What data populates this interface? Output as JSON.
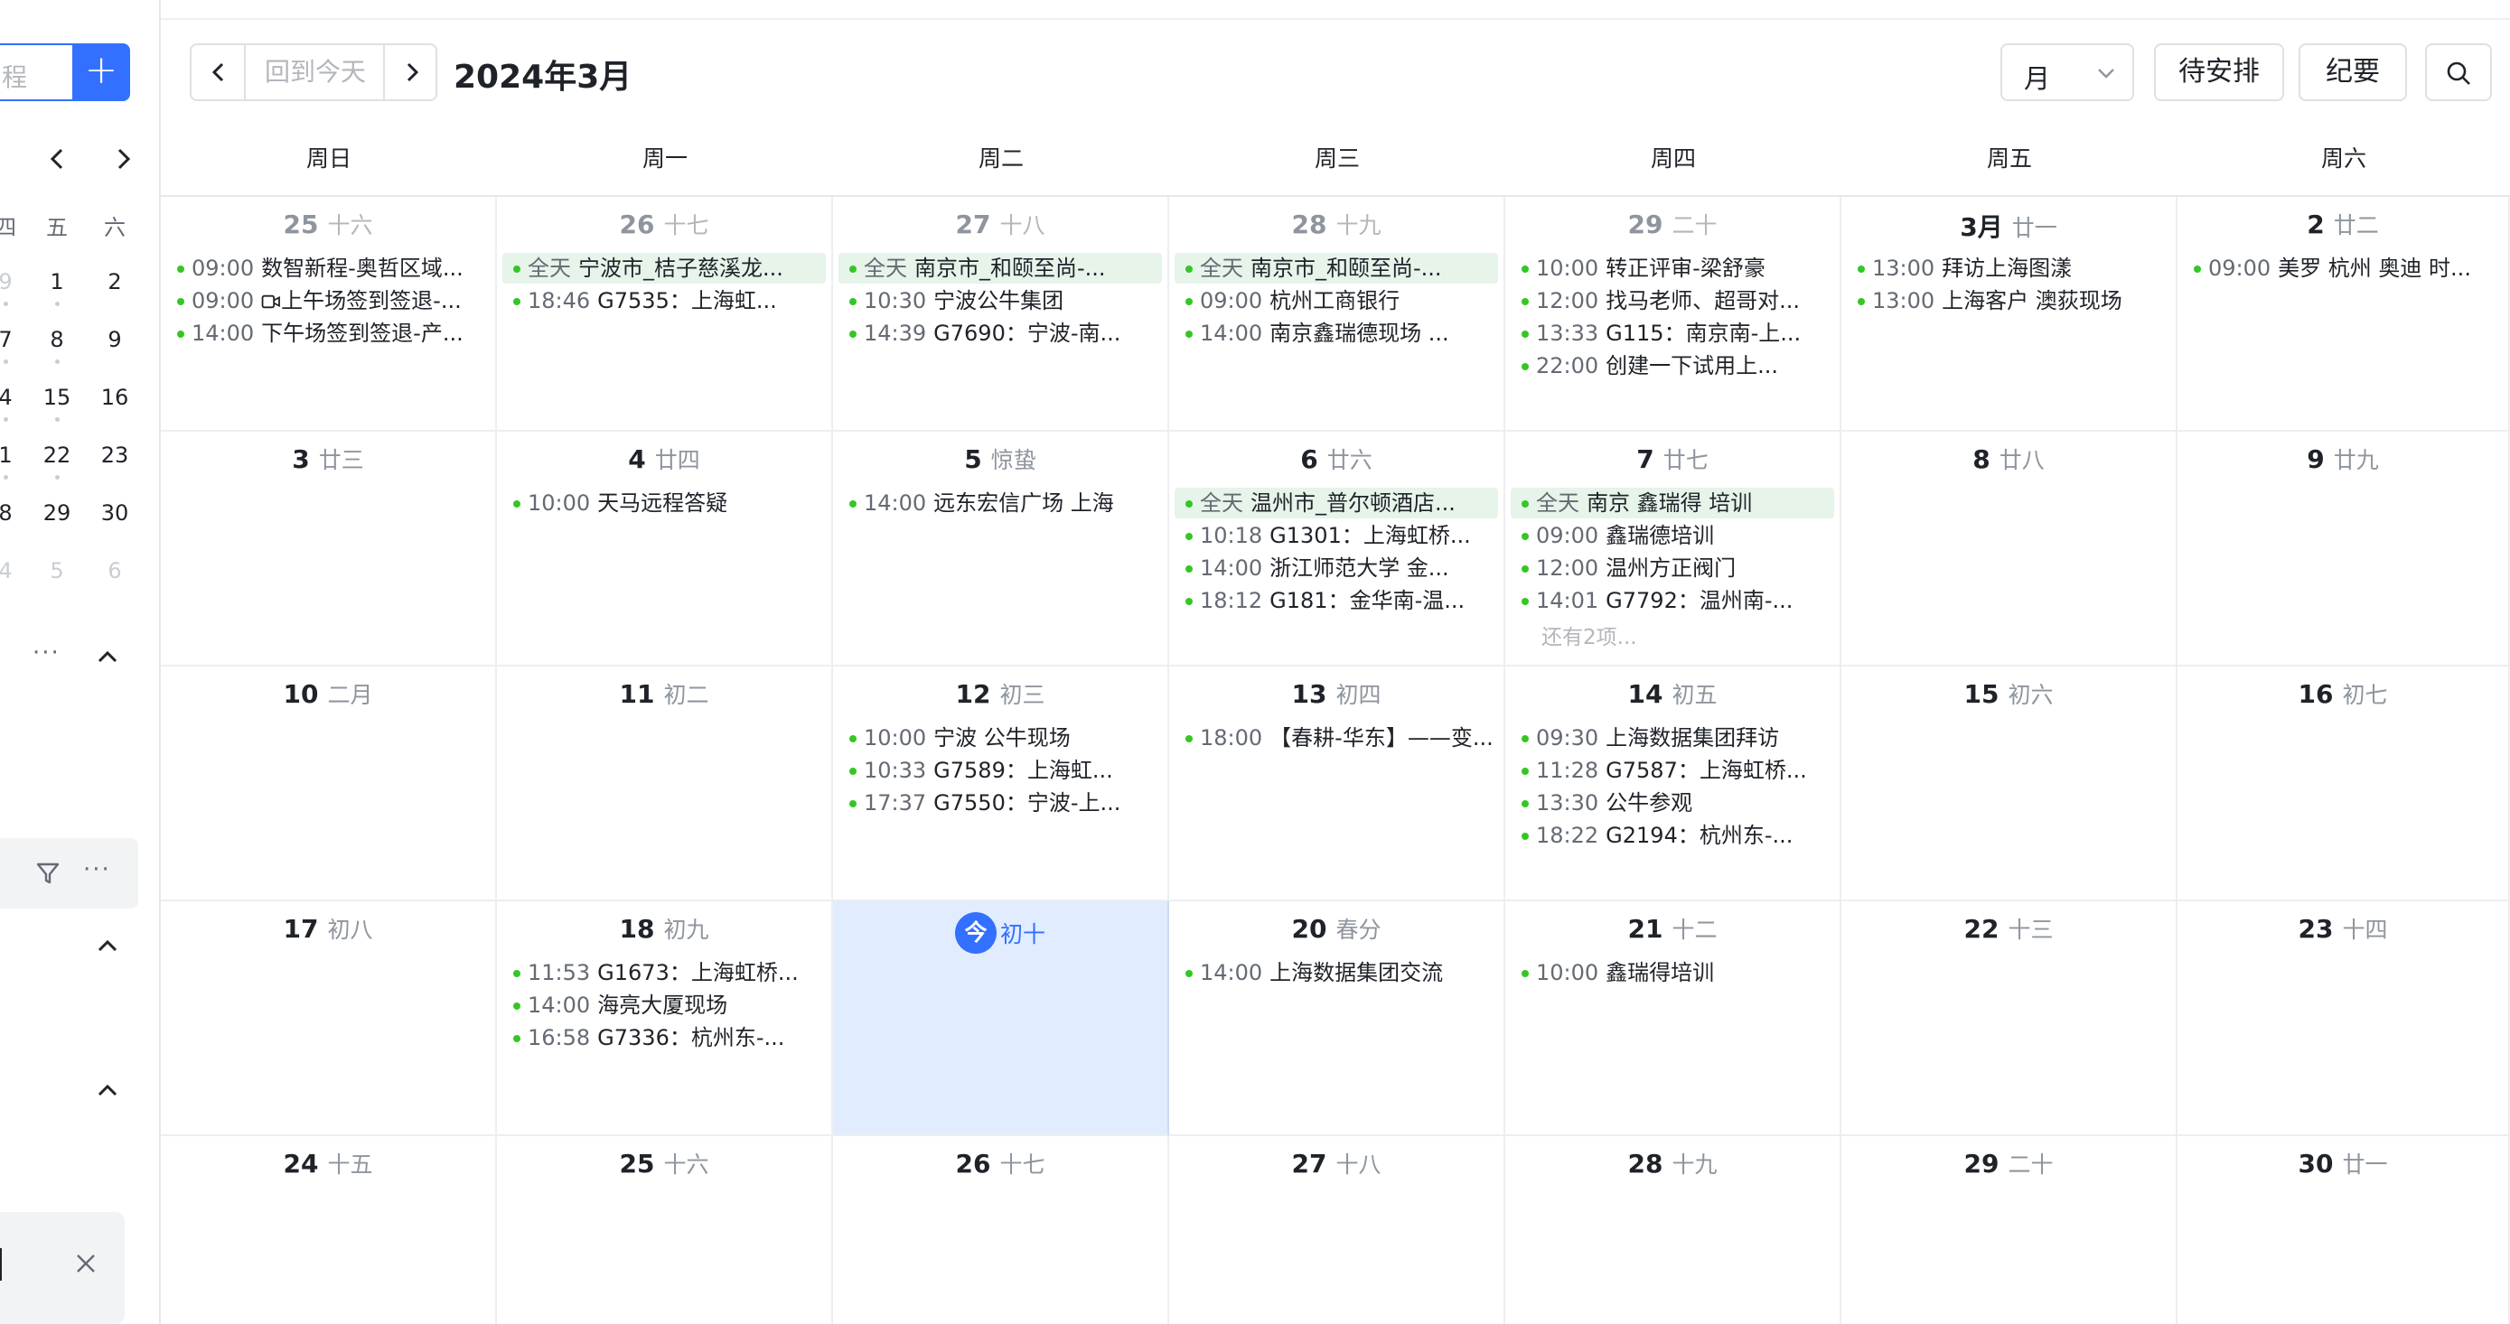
{
  "toolbar": {
    "search_partial": "程",
    "add": "+",
    "today": "回到今天",
    "title": "2024年3月",
    "view": "月",
    "pending": "待安排",
    "minutes": "纪要"
  },
  "mini_calendar": {
    "weekday_heads": [
      "四",
      "五",
      "六"
    ],
    "rows": [
      [
        "9",
        "1",
        "2"
      ],
      [
        "7",
        "8",
        "9"
      ],
      [
        "4",
        "15",
        "16"
      ],
      [
        "1",
        "22",
        "23"
      ],
      [
        "8",
        "29",
        "30"
      ],
      [
        "4",
        "5",
        "6"
      ]
    ]
  },
  "weekdays": [
    "周日",
    "周一",
    "周二",
    "周三",
    "周四",
    "周五",
    "周六"
  ],
  "today_badge": "今",
  "weeks": [
    [
      {
        "num": "25",
        "lunar": "十六",
        "other": true,
        "events": [
          {
            "time": "09:00",
            "title": "数智新程-奥哲区域..."
          },
          {
            "time": "09:00",
            "title": "上午场签到签退-...",
            "icon": "video"
          },
          {
            "time": "14:00",
            "title": "下午场签到签退-产..."
          }
        ]
      },
      {
        "num": "26",
        "lunar": "十七",
        "other": true,
        "events": [
          {
            "time": "全天",
            "title": "宁波市_桔子慈溪龙...",
            "allday": true
          },
          {
            "time": "18:46",
            "title": "G7535：上海虹..."
          }
        ]
      },
      {
        "num": "27",
        "lunar": "十八",
        "other": true,
        "events": [
          {
            "time": "全天",
            "title": "南京市_和颐至尚-...",
            "allday": true
          },
          {
            "time": "10:30",
            "title": "宁波公牛集团"
          },
          {
            "time": "14:39",
            "title": "G7690：宁波-南..."
          }
        ]
      },
      {
        "num": "28",
        "lunar": "十九",
        "other": true,
        "events": [
          {
            "time": "全天",
            "title": "南京市_和颐至尚-...",
            "allday": true
          },
          {
            "time": "09:00",
            "title": "杭州工商银行"
          },
          {
            "time": "14:00",
            "title": "南京鑫瑞德现场 ..."
          }
        ]
      },
      {
        "num": "29",
        "lunar": "二十",
        "other": true,
        "events": [
          {
            "time": "10:00",
            "title": "转正评审-梁舒豪"
          },
          {
            "time": "12:00",
            "title": "找马老师、超哥对..."
          },
          {
            "time": "13:33",
            "title": "G115：南京南-上..."
          },
          {
            "time": "22:00",
            "title": "创建一下试用上..."
          }
        ]
      },
      {
        "num": "3月",
        "lunar": "廿一",
        "events": [
          {
            "time": "13:00",
            "title": "拜访上海图漾"
          },
          {
            "time": "13:00",
            "title": "上海客户 澳荻现场"
          }
        ]
      },
      {
        "num": "2",
        "lunar": "廿二",
        "events": [
          {
            "time": "09:00",
            "title": "美罗 杭州 奥迪 时..."
          }
        ]
      }
    ],
    [
      {
        "num": "3",
        "lunar": "廿三",
        "events": []
      },
      {
        "num": "4",
        "lunar": "廿四",
        "events": [
          {
            "time": "10:00",
            "title": "天马远程答疑"
          }
        ]
      },
      {
        "num": "5",
        "lunar": "惊蛰",
        "events": [
          {
            "time": "14:00",
            "title": "远东宏信广场 上海"
          }
        ]
      },
      {
        "num": "6",
        "lunar": "廿六",
        "events": [
          {
            "time": "全天",
            "title": "温州市_普尔顿酒店...",
            "allday": true
          },
          {
            "time": "10:18",
            "title": "G1301：上海虹桥..."
          },
          {
            "time": "14:00",
            "title": "浙江师范大学 金..."
          },
          {
            "time": "18:12",
            "title": "G181：金华南-温..."
          }
        ]
      },
      {
        "num": "7",
        "lunar": "廿七",
        "more": "还有2项...",
        "events": [
          {
            "time": "全天",
            "title": "南京 鑫瑞得 培训",
            "allday": true
          },
          {
            "time": "09:00",
            "title": "鑫瑞德培训"
          },
          {
            "time": "12:00",
            "title": "温州方正阀门"
          },
          {
            "time": "14:01",
            "title": "G7792：温州南-..."
          }
        ]
      },
      {
        "num": "8",
        "lunar": "廿八",
        "events": []
      },
      {
        "num": "9",
        "lunar": "廿九",
        "events": []
      }
    ],
    [
      {
        "num": "10",
        "lunar": "二月",
        "events": []
      },
      {
        "num": "11",
        "lunar": "初二",
        "events": []
      },
      {
        "num": "12",
        "lunar": "初三",
        "events": [
          {
            "time": "10:00",
            "title": "宁波 公牛现场"
          },
          {
            "time": "10:33",
            "title": "G7589：上海虹..."
          },
          {
            "time": "17:37",
            "title": "G7550：宁波-上..."
          }
        ]
      },
      {
        "num": "13",
        "lunar": "初四",
        "events": [
          {
            "time": "18:00",
            "title": "【春耕-华东】——变..."
          }
        ]
      },
      {
        "num": "14",
        "lunar": "初五",
        "events": [
          {
            "time": "09:30",
            "title": "上海数据集团拜访"
          },
          {
            "time": "11:28",
            "title": "G7587：上海虹桥..."
          },
          {
            "time": "13:30",
            "title": "公牛参观"
          },
          {
            "time": "18:22",
            "title": "G2194：杭州东-..."
          }
        ]
      },
      {
        "num": "15",
        "lunar": "初六",
        "events": []
      },
      {
        "num": "16",
        "lunar": "初七",
        "events": []
      }
    ],
    [
      {
        "num": "17",
        "lunar": "初八",
        "events": []
      },
      {
        "num": "18",
        "lunar": "初九",
        "events": [
          {
            "time": "11:53",
            "title": "G1673：上海虹桥..."
          },
          {
            "time": "14:00",
            "title": "海亮大厦现场"
          },
          {
            "time": "16:58",
            "title": "G7336：杭州东-..."
          }
        ]
      },
      {
        "num": "",
        "lunar": "初十",
        "today": true,
        "events": []
      },
      {
        "num": "20",
        "lunar": "春分",
        "events": [
          {
            "time": "14:00",
            "title": "上海数据集团交流"
          }
        ]
      },
      {
        "num": "21",
        "lunar": "十二",
        "events": [
          {
            "time": "10:00",
            "title": "鑫瑞得培训"
          }
        ]
      },
      {
        "num": "22",
        "lunar": "十三",
        "events": []
      },
      {
        "num": "23",
        "lunar": "十四",
        "events": []
      }
    ],
    [
      {
        "num": "24",
        "lunar": "十五",
        "events": []
      },
      {
        "num": "25",
        "lunar": "十六",
        "events": []
      },
      {
        "num": "26",
        "lunar": "十七",
        "events": []
      },
      {
        "num": "27",
        "lunar": "十八",
        "events": []
      },
      {
        "num": "28",
        "lunar": "十九",
        "events": []
      },
      {
        "num": "29",
        "lunar": "二十",
        "events": []
      },
      {
        "num": "30",
        "lunar": "廿一",
        "events": []
      }
    ]
  ]
}
